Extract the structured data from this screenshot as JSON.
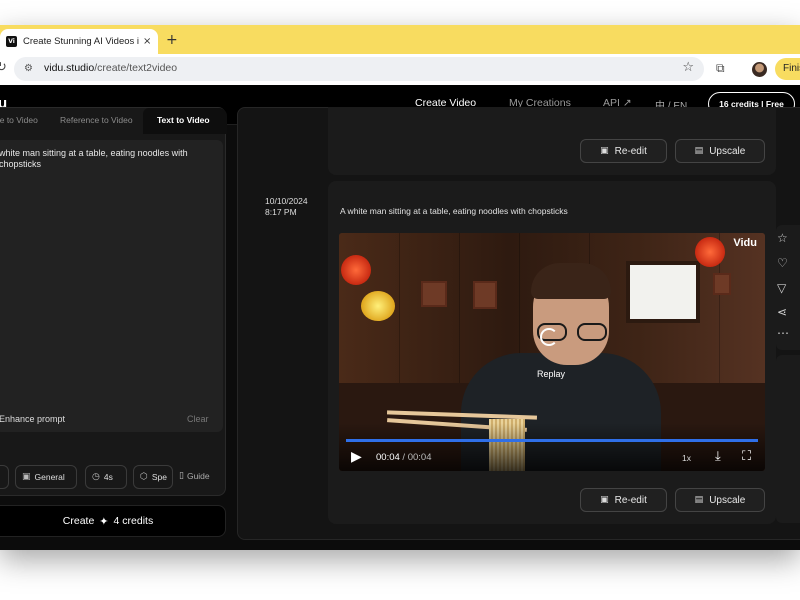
{
  "browser": {
    "tab_title": "Create Stunning AI Videos in",
    "tab_close": "×",
    "new_tab": "+",
    "favicon": "Vi",
    "url_domain": "vidu.studio",
    "url_path": "/create/text2video",
    "finish_label": "Finis"
  },
  "header": {
    "logo": "u",
    "nav": [
      "Create Video",
      "My Creations",
      "API ↗"
    ],
    "lang": "中 / EN",
    "credits": "16 credits | Free"
  },
  "left": {
    "tabs": [
      "ge to Video",
      "Reference to Video",
      "Text to Video"
    ],
    "prompt": "white man sitting at a table, eating noodles with chopsticks",
    "enhance": "Enhance prompt",
    "clear": "Clear",
    "options": [
      "General",
      "4s",
      "Spe"
    ],
    "guide": "Guide",
    "create": {
      "label": "Create",
      "credits": "4 credits"
    }
  },
  "results": {
    "card1": {
      "reedit": "Re-edit",
      "upscale": "Upscale"
    },
    "card2": {
      "date": "10/10/2024",
      "time": "8:17 PM",
      "caption": "A white man sitting at a table, eating noodles with chopsticks",
      "reedit": "Re-edit",
      "upscale": "Upscale"
    }
  },
  "player": {
    "watermark": "Vidu",
    "replay": "Replay",
    "current": "00:04",
    "separator": "/",
    "duration": "00:04",
    "speed": "1x",
    "progress_fraction": 1.0,
    "accent": "#2f6fe8"
  },
  "colors": {
    "tab_strip": "#f8dc60",
    "app_bg": "#0c0c0c"
  }
}
